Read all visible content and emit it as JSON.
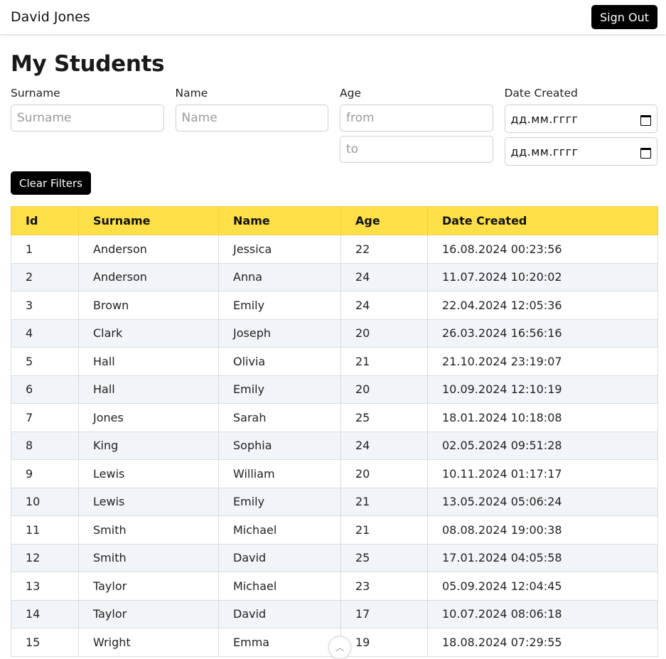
{
  "header": {
    "user_name": "David Jones",
    "signout_label": "Sign Out"
  },
  "page_title": "My Students",
  "filters": {
    "surname": {
      "label": "Surname",
      "placeholder": "Surname"
    },
    "name": {
      "label": "Name",
      "placeholder": "Name"
    },
    "age": {
      "label": "Age",
      "from_placeholder": "from",
      "to_placeholder": "to"
    },
    "date_created": {
      "label": "Date Created",
      "from_value": "дд.мм.гггг",
      "to_value": "дд.мм.гггг"
    },
    "clear_label": "Clear Filters"
  },
  "table": {
    "columns": [
      "Id",
      "Surname",
      "Name",
      "Age",
      "Date Created"
    ],
    "rows": [
      [
        "1",
        "Anderson",
        "Jessica",
        "22",
        "16.08.2024 00:23:56"
      ],
      [
        "2",
        "Anderson",
        "Anna",
        "24",
        "11.07.2024 10:20:02"
      ],
      [
        "3",
        "Brown",
        "Emily",
        "24",
        "22.04.2024 12:05:36"
      ],
      [
        "4",
        "Clark",
        "Joseph",
        "20",
        "26.03.2024 16:56:16"
      ],
      [
        "5",
        "Hall",
        "Olivia",
        "21",
        "21.10.2024 23:19:07"
      ],
      [
        "6",
        "Hall",
        "Emily",
        "20",
        "10.09.2024 12:10:19"
      ],
      [
        "7",
        "Jones",
        "Sarah",
        "25",
        "18.01.2024 10:18:08"
      ],
      [
        "8",
        "King",
        "Sophia",
        "24",
        "02.05.2024 09:51:28"
      ],
      [
        "9",
        "Lewis",
        "William",
        "20",
        "10.11.2024 01:17:17"
      ],
      [
        "10",
        "Lewis",
        "Emily",
        "21",
        "13.05.2024 05:06:24"
      ],
      [
        "11",
        "Smith",
        "Michael",
        "21",
        "08.08.2024 19:00:38"
      ],
      [
        "12",
        "Smith",
        "David",
        "25",
        "17.01.2024 04:05:58"
      ],
      [
        "13",
        "Taylor",
        "Michael",
        "23",
        "05.09.2024 12:04:45"
      ],
      [
        "14",
        "Taylor",
        "David",
        "17",
        "10.07.2024 08:06:18"
      ],
      [
        "15",
        "Wright",
        "Emma",
        "19",
        "18.08.2024 07:29:55"
      ]
    ]
  },
  "colors": {
    "header_row": "#fde047",
    "button": "#000000",
    "stripe": "#f1f4f8"
  },
  "icons": {
    "date_picker": "calendar-icon",
    "scroll_up": "chevron-up-icon"
  }
}
